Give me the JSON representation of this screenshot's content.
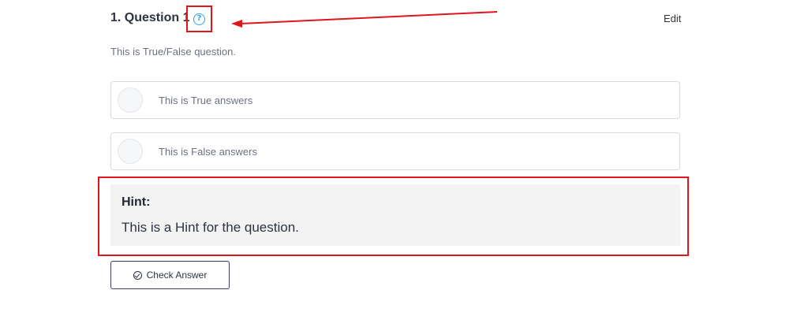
{
  "question": {
    "title": "1. Question 1",
    "help_icon": "question-circle-icon",
    "edit_label": "Edit",
    "description": "This is True/False question."
  },
  "answers": [
    {
      "label": "This is True answers",
      "selected": false
    },
    {
      "label": "This is False answers",
      "selected": false
    }
  ],
  "hint": {
    "title": "Hint:",
    "text": "This is a Hint for the question."
  },
  "check_button": {
    "label": "Check Answer",
    "icon": "check-circle-icon"
  },
  "colors": {
    "annotation_red": "#e0151c",
    "help_icon_blue": "#2aa1e6",
    "hint_background": "#f3f3f3",
    "button_border": "#3c3b6e"
  }
}
